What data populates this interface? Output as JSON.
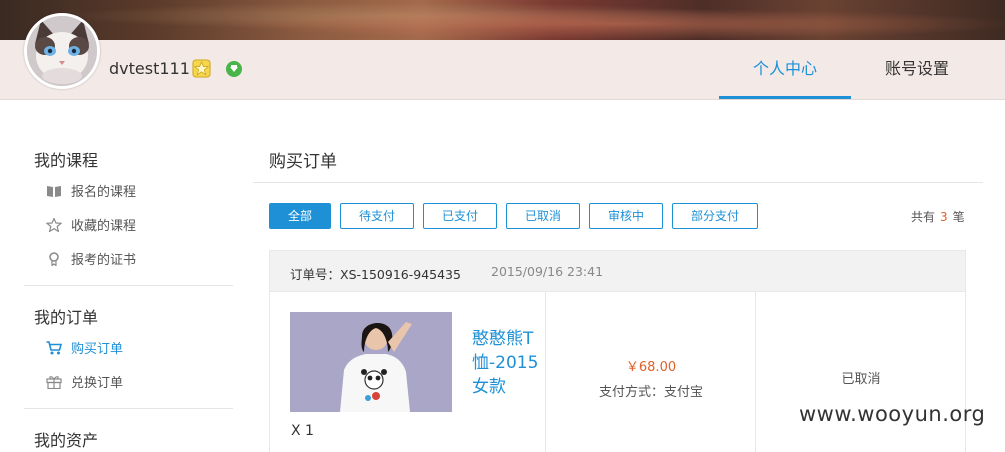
{
  "header": {
    "username": "dvtest111",
    "tabs": [
      {
        "label": "个人中心",
        "active": true
      },
      {
        "label": "账号设置",
        "active": false
      }
    ],
    "accent_color": "#1e90d6"
  },
  "sidebar": {
    "groups": [
      {
        "title": "我的课程",
        "items": [
          {
            "label": "报名的课程",
            "icon": "book-icon"
          },
          {
            "label": "收藏的课程",
            "icon": "star-outline-icon"
          },
          {
            "label": "报考的证书",
            "icon": "medal-icon"
          }
        ]
      },
      {
        "title": "我的订单",
        "items": [
          {
            "label": "购买订单",
            "icon": "cart-icon",
            "active": true
          },
          {
            "label": "兑换订单",
            "icon": "gift-icon"
          }
        ]
      },
      {
        "title": "我的资产",
        "items": []
      }
    ]
  },
  "main": {
    "title": "购买订单",
    "filters": [
      {
        "label": "全部",
        "active": true
      },
      {
        "label": "待支付"
      },
      {
        "label": "已支付"
      },
      {
        "label": "已取消"
      },
      {
        "label": "审核中"
      },
      {
        "label": "部分支付"
      }
    ],
    "total": {
      "prefix": "共有",
      "count": "3",
      "suffix": "笔"
    },
    "orders": [
      {
        "order_no": "订单号：XS-150916-945435",
        "time": "2015/09/16 23:41",
        "product_name": "憨憨熊T恤-2015女款",
        "quantity": "X 1",
        "price": "￥68.00",
        "pay_method": "支付方式：支付宝",
        "status": "已取消"
      }
    ]
  },
  "watermark": "www.wooyun.org"
}
